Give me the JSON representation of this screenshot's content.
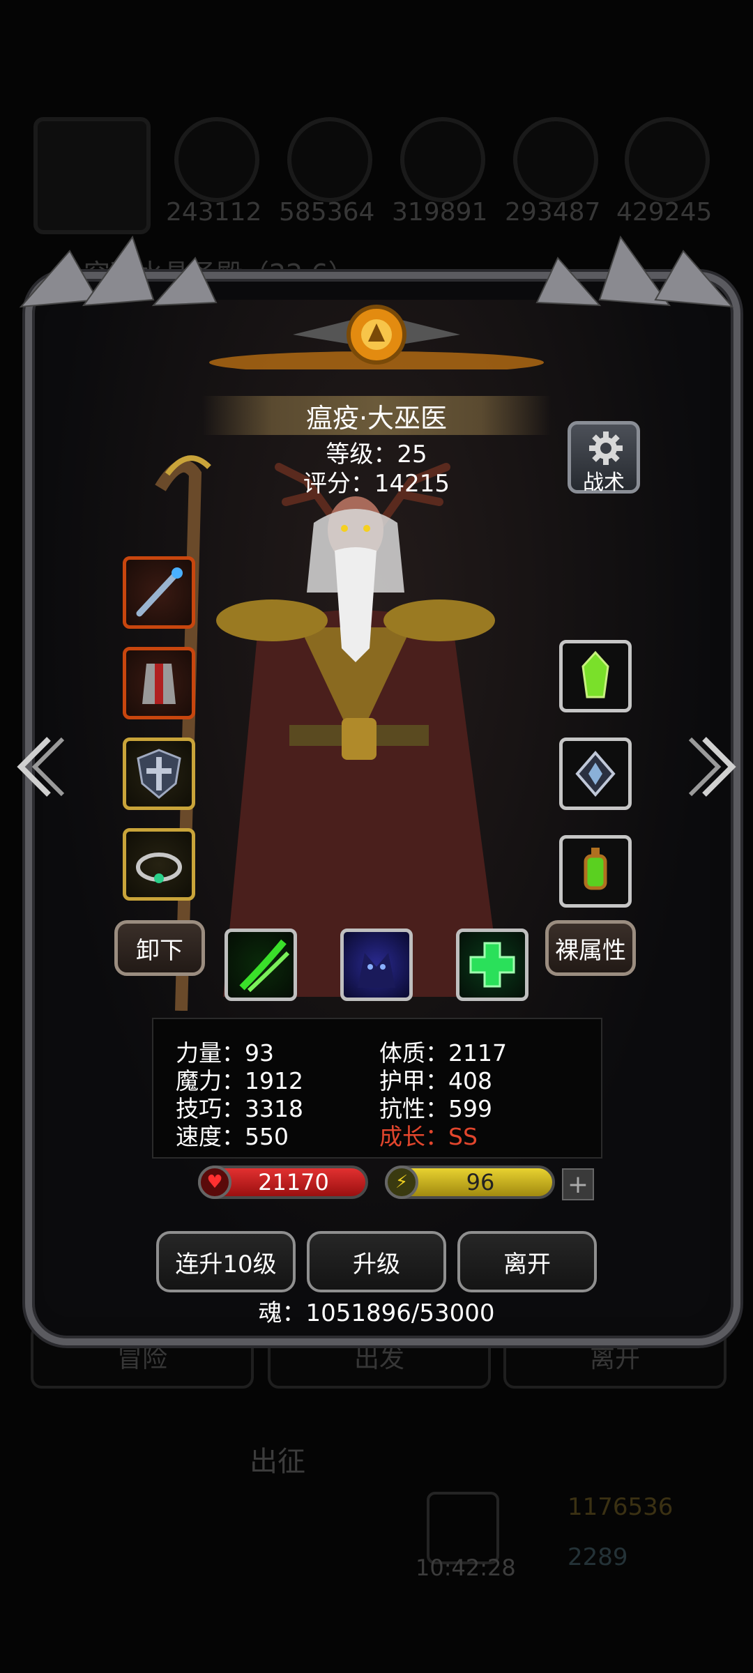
{
  "background": {
    "resources": [
      "243112",
      "585364",
      "319891",
      "293487",
      "429245"
    ],
    "quest_text": "突破水晶圣殿（22.6）",
    "buttons": [
      "冒险",
      "出发",
      "离开"
    ],
    "expedition_label": "出征",
    "time": "10:42:28",
    "gold": "1176536",
    "gems": "2289"
  },
  "hero": {
    "name": "瘟疫·大巫医",
    "level_line": "等级：25",
    "score_line": "评分：14215"
  },
  "tactics_label": "战术",
  "equipment_slots": [
    {
      "icon": "staff-icon",
      "rarity": "red"
    },
    {
      "icon": "chest-armor-icon",
      "rarity": "red"
    },
    {
      "icon": "shield-icon",
      "rarity": "gold"
    },
    {
      "icon": "ring-icon",
      "rarity": "gold"
    },
    {
      "icon": "green-crystal-icon",
      "rarity": "gray"
    },
    {
      "icon": "emblem-icon",
      "rarity": "gray"
    },
    {
      "icon": "lantern-icon",
      "rarity": "gray"
    }
  ],
  "skills": [
    "green-claw-icon",
    "shadow-beast-icon",
    "heal-cross-icon"
  ],
  "unequip_label": "卸下",
  "base_attr_label": "裸属性",
  "stats": {
    "left": [
      "力量：93",
      "魔力：1912",
      "技巧：3318",
      "速度：550"
    ],
    "right": [
      "体质：2117",
      "护甲：408",
      "抗性：599"
    ],
    "growth": "成长：SS"
  },
  "hp_value": "21170",
  "energy_value": "96",
  "plus_label": "+",
  "actions": {
    "level10": "连升10级",
    "level": "升级",
    "leave": "离开"
  },
  "soul_line": "魂：1051896/53000",
  "colors": {
    "hp": "#d42020",
    "energy": "#d8c020",
    "growth": "#e2462d",
    "frame": "#5b5b60"
  }
}
